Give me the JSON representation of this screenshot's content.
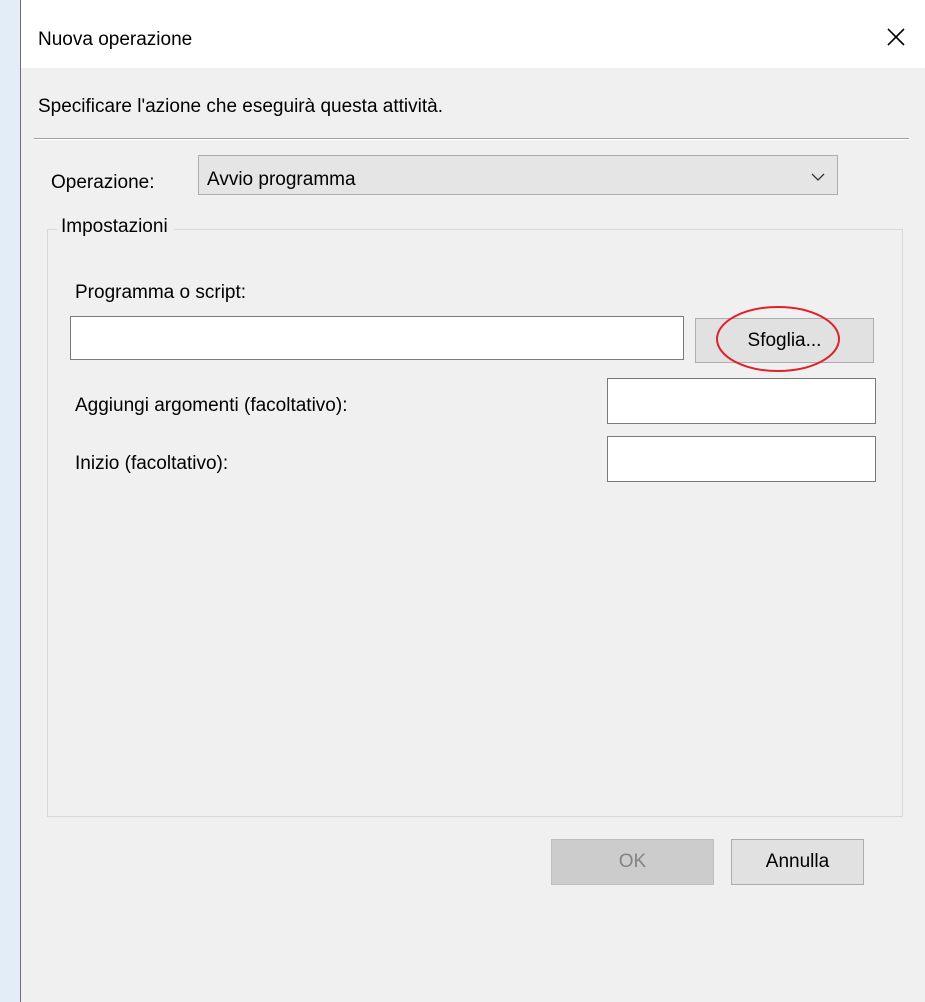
{
  "dialog": {
    "title": "Nuova operazione",
    "close_icon": "close-icon",
    "instruction": "Specificare l'azione che eseguirà questa attività."
  },
  "operation": {
    "label": "Operazione:",
    "selected": "Avvio programma"
  },
  "settings": {
    "legend": "Impostazioni",
    "program_label": "Programma o script:",
    "program_value": "",
    "browse_label": "Sfoglia...",
    "arguments_label": "Aggiungi argomenti (facoltativo):",
    "arguments_value": "",
    "start_label": "Inizio (facoltativo):",
    "start_value": ""
  },
  "buttons": {
    "ok_label": "OK",
    "cancel_label": "Annulla"
  },
  "annotation": {
    "highlight_color": "#e0202a"
  }
}
